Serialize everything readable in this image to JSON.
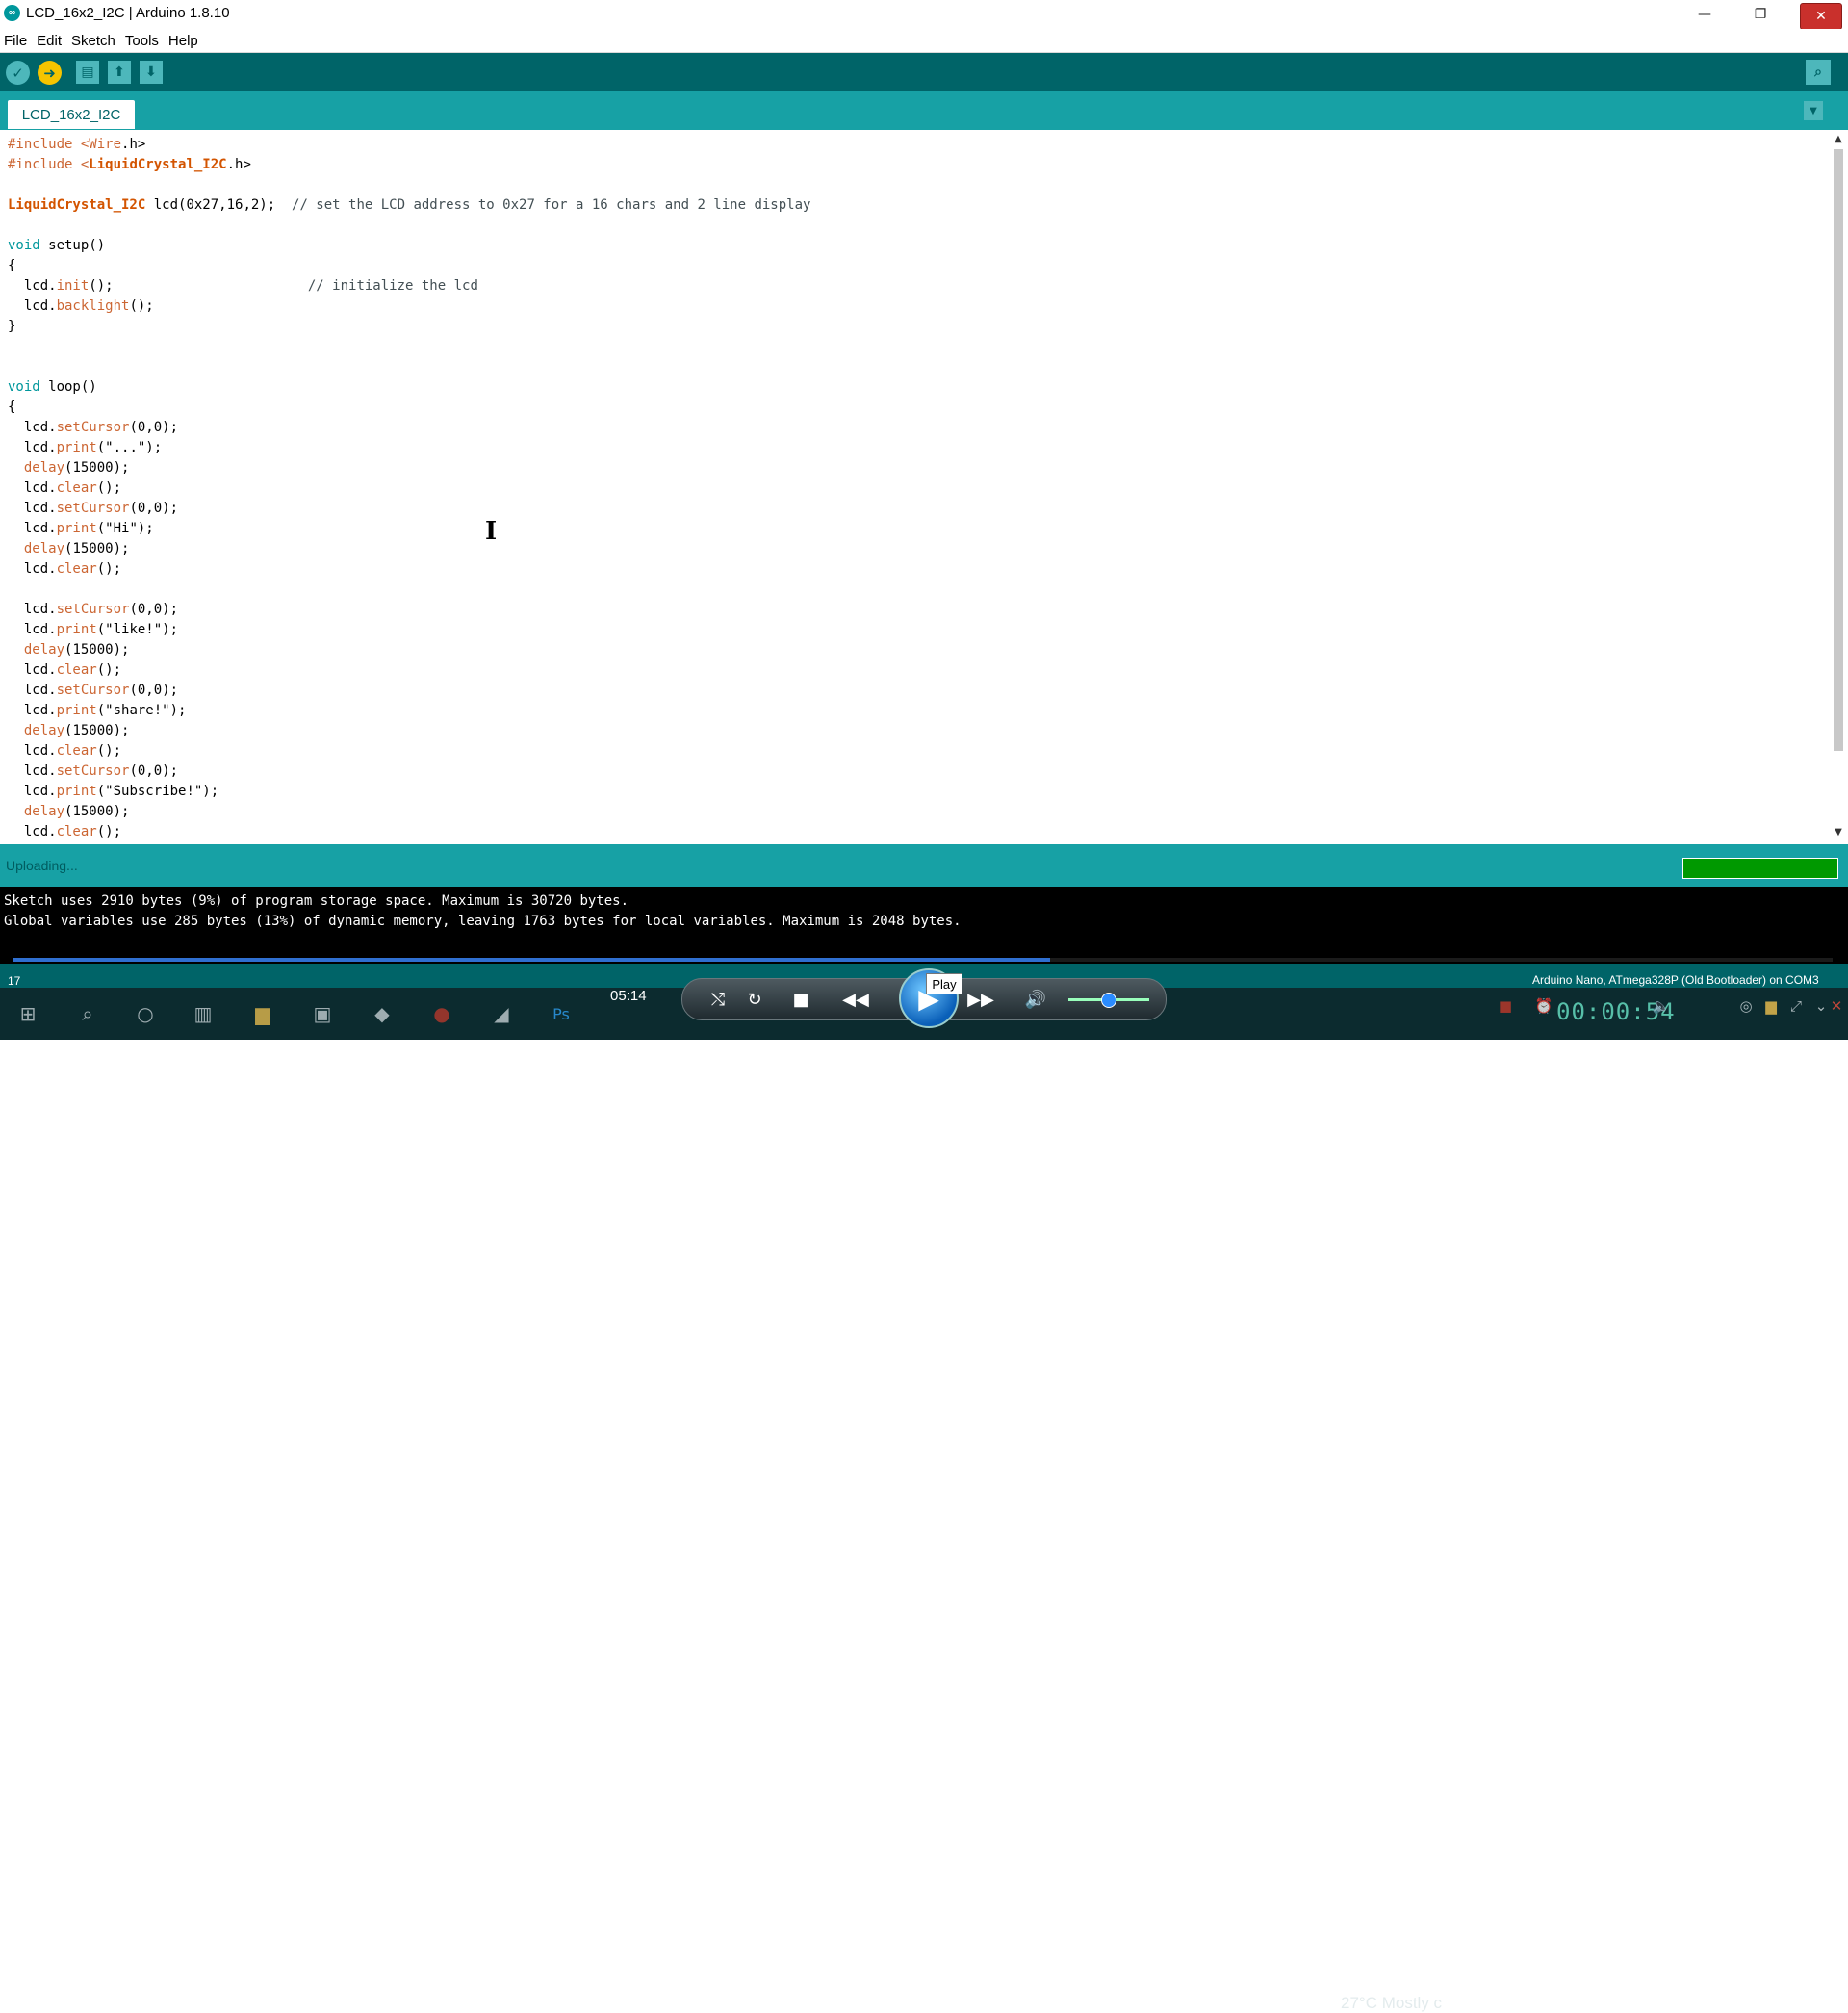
{
  "window": {
    "title": "LCD_16x2_I2C | Arduino 1.8.10",
    "app_icon": "∞",
    "min_icon": "—",
    "max_icon": "❐",
    "close_icon": "✕"
  },
  "menu": {
    "items": [
      "File",
      "Edit",
      "Sketch",
      "Tools",
      "Help"
    ]
  },
  "toolbar": {
    "verify_icon": "✓",
    "upload_icon": "➜",
    "new_icon": "▤",
    "open_icon": "⬆",
    "save_icon": "⬇",
    "serial_icon": "⌕"
  },
  "tab": {
    "label": "LCD_16x2_I2C",
    "menu_icon": "▼"
  },
  "code": {
    "l1": {
      "dir": "#include <",
      "lib": "Wire",
      "end": ".h>"
    },
    "l2": {
      "dir": "#include <",
      "lib": "LiquidCrystal_I2C",
      "end": ".h>"
    },
    "l3": {
      "type": "LiquidCrystal_I2C",
      "rest": " lcd(0x27,16,2);  ",
      "comment": "// set the LCD address to 0x27 for a 16 chars and 2 line display"
    },
    "l4": {
      "kw": "void",
      "rest": " setup()"
    },
    "brace_open": "{",
    "brace_close": "}",
    "l6": {
      "obj": "  lcd.",
      "fn": "init",
      "rest": "();                        ",
      "comment": "// initialize the lcd"
    },
    "l7": {
      "obj": "  lcd.",
      "fn": "backlight",
      "rest": "();"
    },
    "l9": {
      "kw": "void",
      "rest": " loop()"
    },
    "loop_lines": [
      {
        "obj": "  lcd.",
        "fn": "setCursor",
        "rest": "(0,0);"
      },
      {
        "obj": "  lcd.",
        "fn": "print",
        "rest": "(\"...\");"
      },
      {
        "obj": "  ",
        "fn": "delay",
        "rest": "(15000);"
      },
      {
        "obj": "  lcd.",
        "fn": "clear",
        "rest": "();"
      },
      {
        "obj": "  lcd.",
        "fn": "setCursor",
        "rest": "(0,0);"
      },
      {
        "obj": "  lcd.",
        "fn": "print",
        "rest": "(\"Hi\");"
      },
      {
        "obj": "  ",
        "fn": "delay",
        "rest": "(15000);"
      },
      {
        "obj": "  lcd.",
        "fn": "clear",
        "rest": "();"
      },
      {
        "obj": "",
        "fn": "",
        "rest": ""
      },
      {
        "obj": "  lcd.",
        "fn": "setCursor",
        "rest": "(0,0);"
      },
      {
        "obj": "  lcd.",
        "fn": "print",
        "rest": "(\"like!\");"
      },
      {
        "obj": "  ",
        "fn": "delay",
        "rest": "(15000);"
      },
      {
        "obj": "  lcd.",
        "fn": "clear",
        "rest": "();"
      },
      {
        "obj": "  lcd.",
        "fn": "setCursor",
        "rest": "(0,0);"
      },
      {
        "obj": "  lcd.",
        "fn": "print",
        "rest": "(\"share!\");"
      },
      {
        "obj": "  ",
        "fn": "delay",
        "rest": "(15000);"
      },
      {
        "obj": "  lcd.",
        "fn": "clear",
        "rest": "();"
      },
      {
        "obj": "  lcd.",
        "fn": "setCursor",
        "rest": "(0,0);"
      },
      {
        "obj": "  lcd.",
        "fn": "print",
        "rest": "(\"Subscribe!\");"
      },
      {
        "obj": "  ",
        "fn": "delay",
        "rest": "(15000);"
      },
      {
        "obj": "  lcd.",
        "fn": "clear",
        "rest": "();"
      }
    ]
  },
  "status": {
    "text": "Uploading...",
    "progress": 1.0
  },
  "console": {
    "line1": "Sketch uses 2910 bytes (9%) of program storage space. Maximum is 30720 bytes.",
    "line2": "Global variables use 285 bytes (13%) of dynamic memory, leaving 1763 bytes for local variables. Maximum is 2048 bytes."
  },
  "footer": {
    "line_number": "17",
    "board": "Arduino Nano, ATmega328P (Old Bootloader) on COM3"
  },
  "taskbar": {
    "media_time": "05:14",
    "play_tooltip": "Play",
    "weather": "27°C  Mostly c",
    "tray_clock": "00:00:54",
    "icons": {
      "start": "⊞",
      "search": "⌕",
      "cortana": "○",
      "taskview": "▥",
      "explorer": "▆",
      "store": "▣",
      "app1": "◆",
      "app2": "●",
      "app3": "◢",
      "photoshop": "Ps",
      "media_shuffle": "⤭",
      "media_repeat": "↻",
      "media_stop": "■",
      "media_prev": "◀◀",
      "media_play": "▶",
      "media_next": "▶▶",
      "media_volume": "🔊"
    }
  },
  "colors": {
    "teal_dark": "#006468",
    "teal": "#17a1a5",
    "accent_yellow": "#f5c400",
    "progress_green": "#009900"
  }
}
